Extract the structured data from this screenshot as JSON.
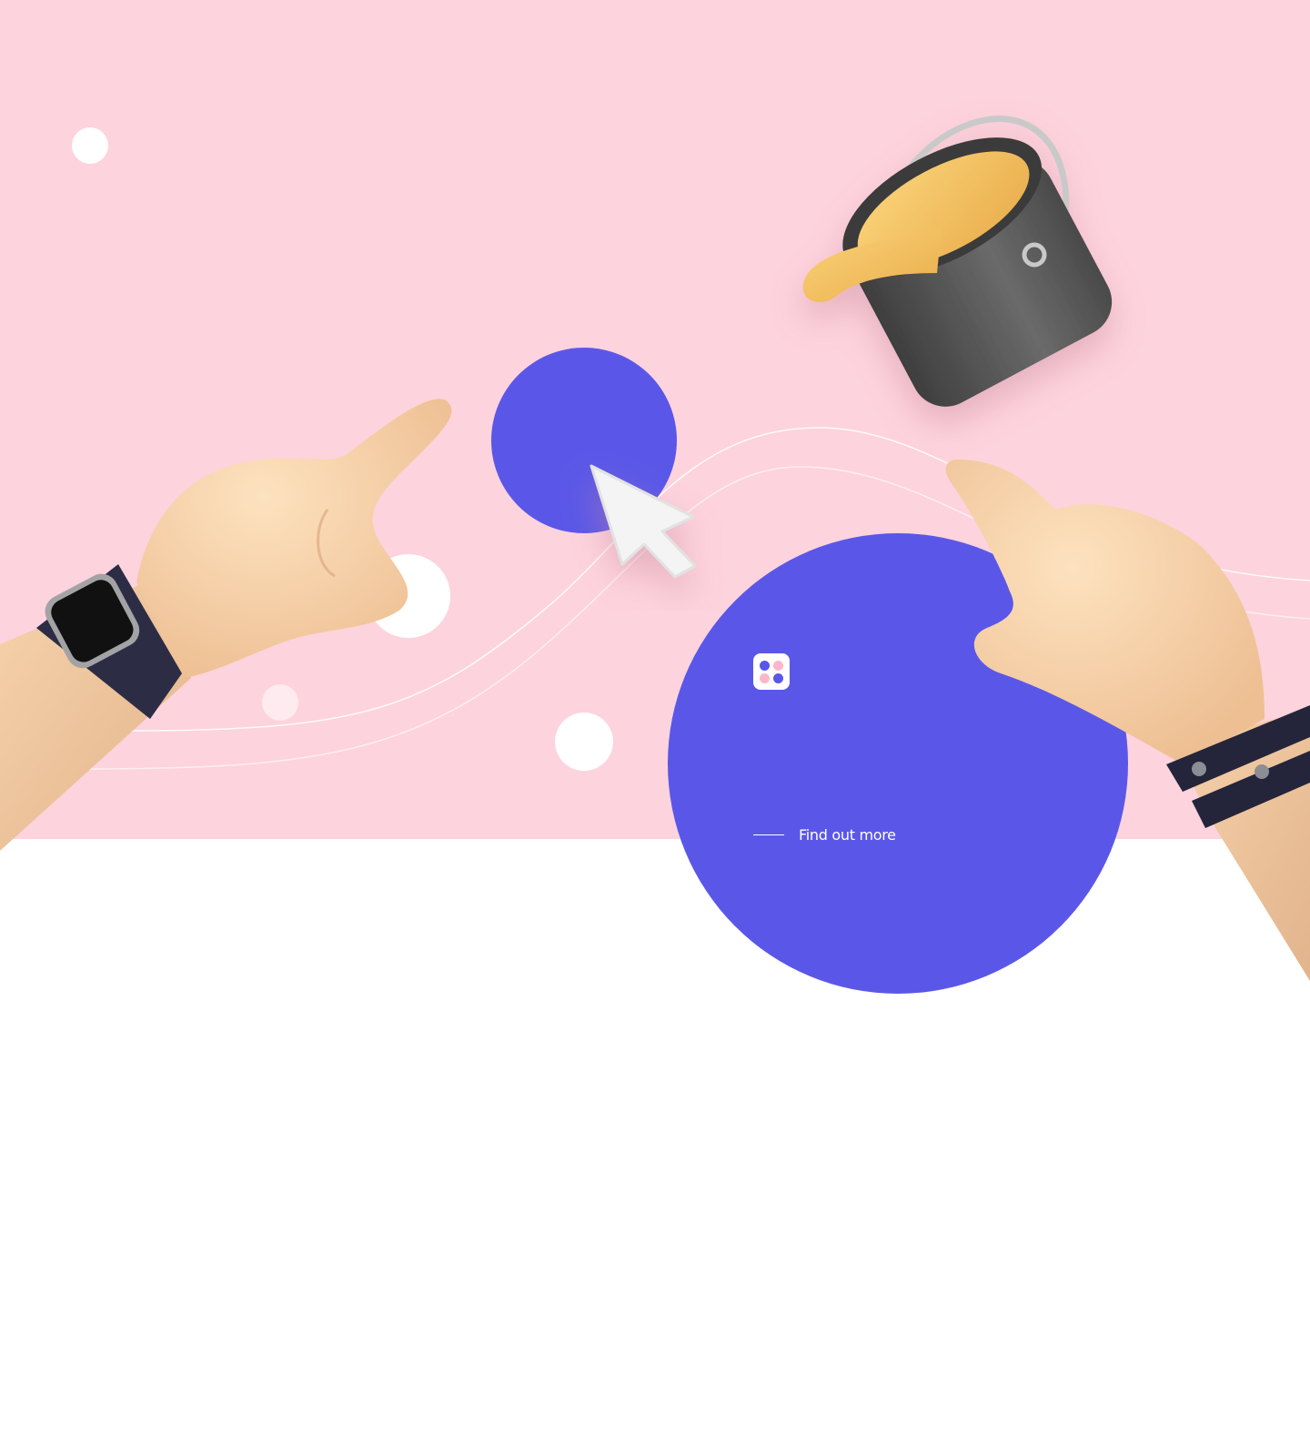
{
  "colors": {
    "hero_background": "#fdd3dd",
    "accent": "#5a57e8",
    "page_background": "#ffffff",
    "paint": "#f3c15e",
    "bucket": "#5a5a5a"
  },
  "icons": {
    "app_badge": "four-dots-grid-icon",
    "cursor": "mouse-pointer-icon",
    "paint_bucket": "paint-bucket-icon",
    "left_hand": "pointing-hand-with-watch",
    "right_hand": "pointing-hand-with-bracelet"
  },
  "hero": {
    "cta_label": "Find out more"
  }
}
